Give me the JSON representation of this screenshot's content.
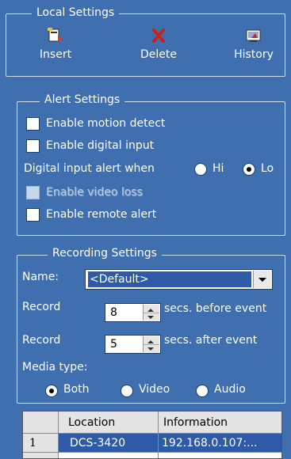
{
  "local_settings": {
    "title": "Local Settings",
    "buttons": [
      {
        "label": "Insert",
        "icon": "insert-icon"
      },
      {
        "label": "Delete",
        "icon": "delete-icon"
      },
      {
        "label": "History",
        "icon": "history-icon"
      }
    ]
  },
  "alert_settings": {
    "title": "Alert Settings",
    "enable_motion_detect": "Enable motion detect",
    "enable_digital_input": "Enable digital input",
    "digital_input_alert_when": "Digital input alert when",
    "hi_label": "Hi",
    "lo_label": "Lo",
    "selected_level": "Lo",
    "enable_video_loss": "Enable video loss",
    "enable_remote_alert": "Enable remote alert"
  },
  "recording_settings": {
    "title": "Recording Settings",
    "name_label": "Name:",
    "name_value": "<Default>",
    "record_label": "Record",
    "before_value": "8",
    "before_suffix": "secs. before event",
    "after_value": "5",
    "after_suffix": "secs. after event",
    "media_type_label": "Media type:",
    "media_both": "Both",
    "media_video": "Video",
    "media_audio": "Audio",
    "media_selected": "Both"
  },
  "device_table": {
    "columns": [
      "Location",
      "Information"
    ],
    "rows": [
      {
        "index": "1",
        "location": "DCS-3420",
        "information": "192.168.0.107:..."
      }
    ]
  }
}
